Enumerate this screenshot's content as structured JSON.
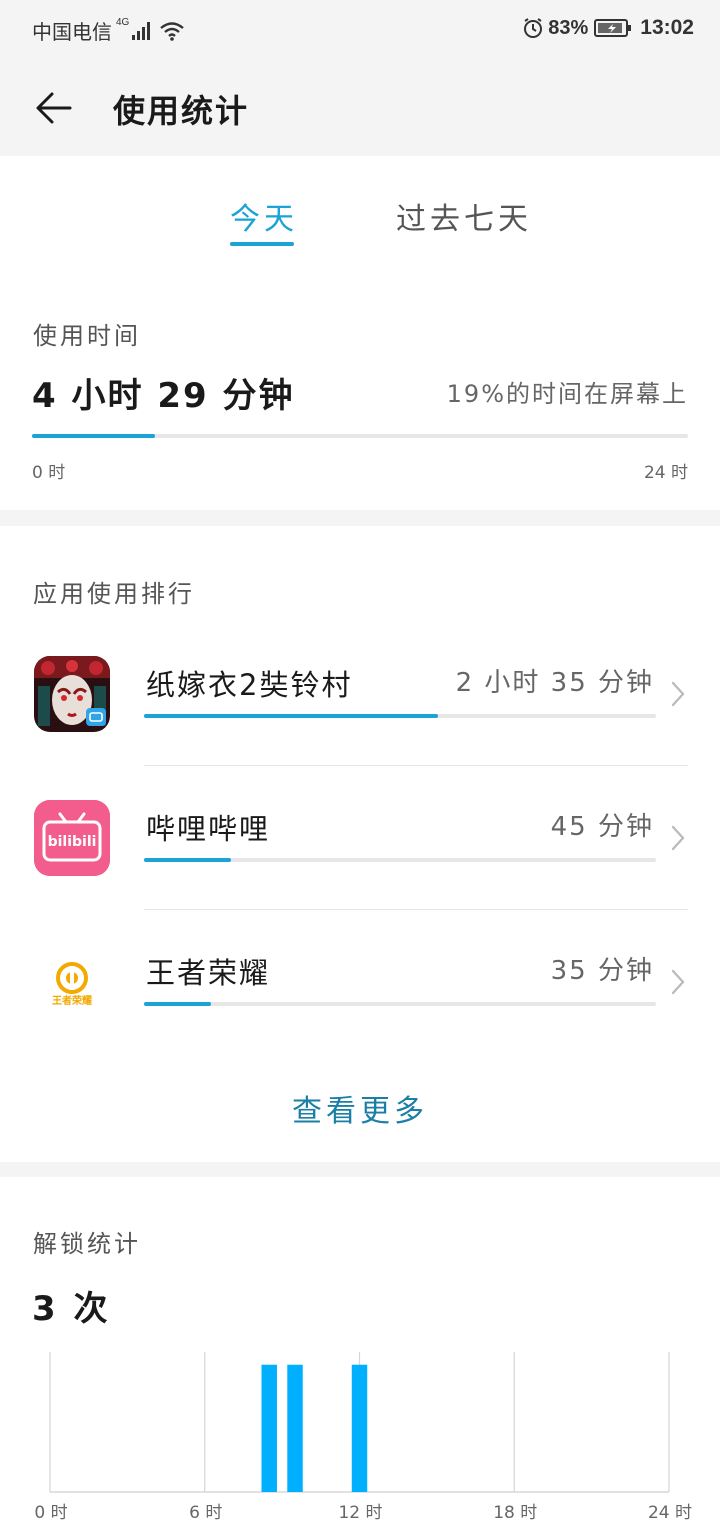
{
  "status_bar": {
    "carrier": "中国电信",
    "network_badge": "4G",
    "battery_percent": "83%",
    "time": "13:02",
    "icons": [
      "signal-icon",
      "wifi-icon",
      "alarm-icon",
      "battery-icon"
    ]
  },
  "app_bar": {
    "title": "使用统计",
    "back_icon": "back-arrow-icon"
  },
  "tabs": [
    {
      "label": "今天",
      "active": true
    },
    {
      "label": "过去七天",
      "active": false
    }
  ],
  "usage": {
    "label": "使用时间",
    "total": "4 小时 29 分钟",
    "percent_on_screen": "19%的时间在屏幕上",
    "progress_fraction": 0.187,
    "axis_min": "0 时",
    "axis_max": "24 时"
  },
  "ranking": {
    "label": "应用使用排行",
    "apps": [
      {
        "name": "纸嫁衣2奘铃村",
        "time": "2 小时 35 分钟",
        "usage_fraction": 0.575,
        "icon": "game-opera-mask-icon"
      },
      {
        "name": "哔哩哔哩",
        "time": "45 分钟",
        "usage_fraction": 0.17,
        "icon": "bilibili-icon",
        "icon_text": "bilibili"
      },
      {
        "name": "王者荣耀",
        "time": "35 分钟",
        "usage_fraction": 0.13,
        "icon": "honor-of-kings-icon",
        "icon_text": "王者荣耀"
      }
    ],
    "see_more": "查看更多"
  },
  "unlock": {
    "label": "解锁统计",
    "count": "3 次"
  },
  "chart_data": {
    "type": "bar",
    "xlabel": "",
    "ylabel": "",
    "x_ticks": [
      "0 时",
      "6 时",
      "12 时",
      "18 时",
      "24 时"
    ],
    "x_range": [
      0,
      24
    ],
    "bars": [
      {
        "hour": 8,
        "value": 1
      },
      {
        "hour": 9,
        "value": 1
      },
      {
        "hour": 11.5,
        "value": 1
      }
    ],
    "ylim": [
      0,
      1.1
    ],
    "bar_color": "#00b0ff"
  },
  "colors": {
    "accent": "#1aa3d4",
    "link": "#1a7ea6",
    "bar": "#00b0ff"
  }
}
